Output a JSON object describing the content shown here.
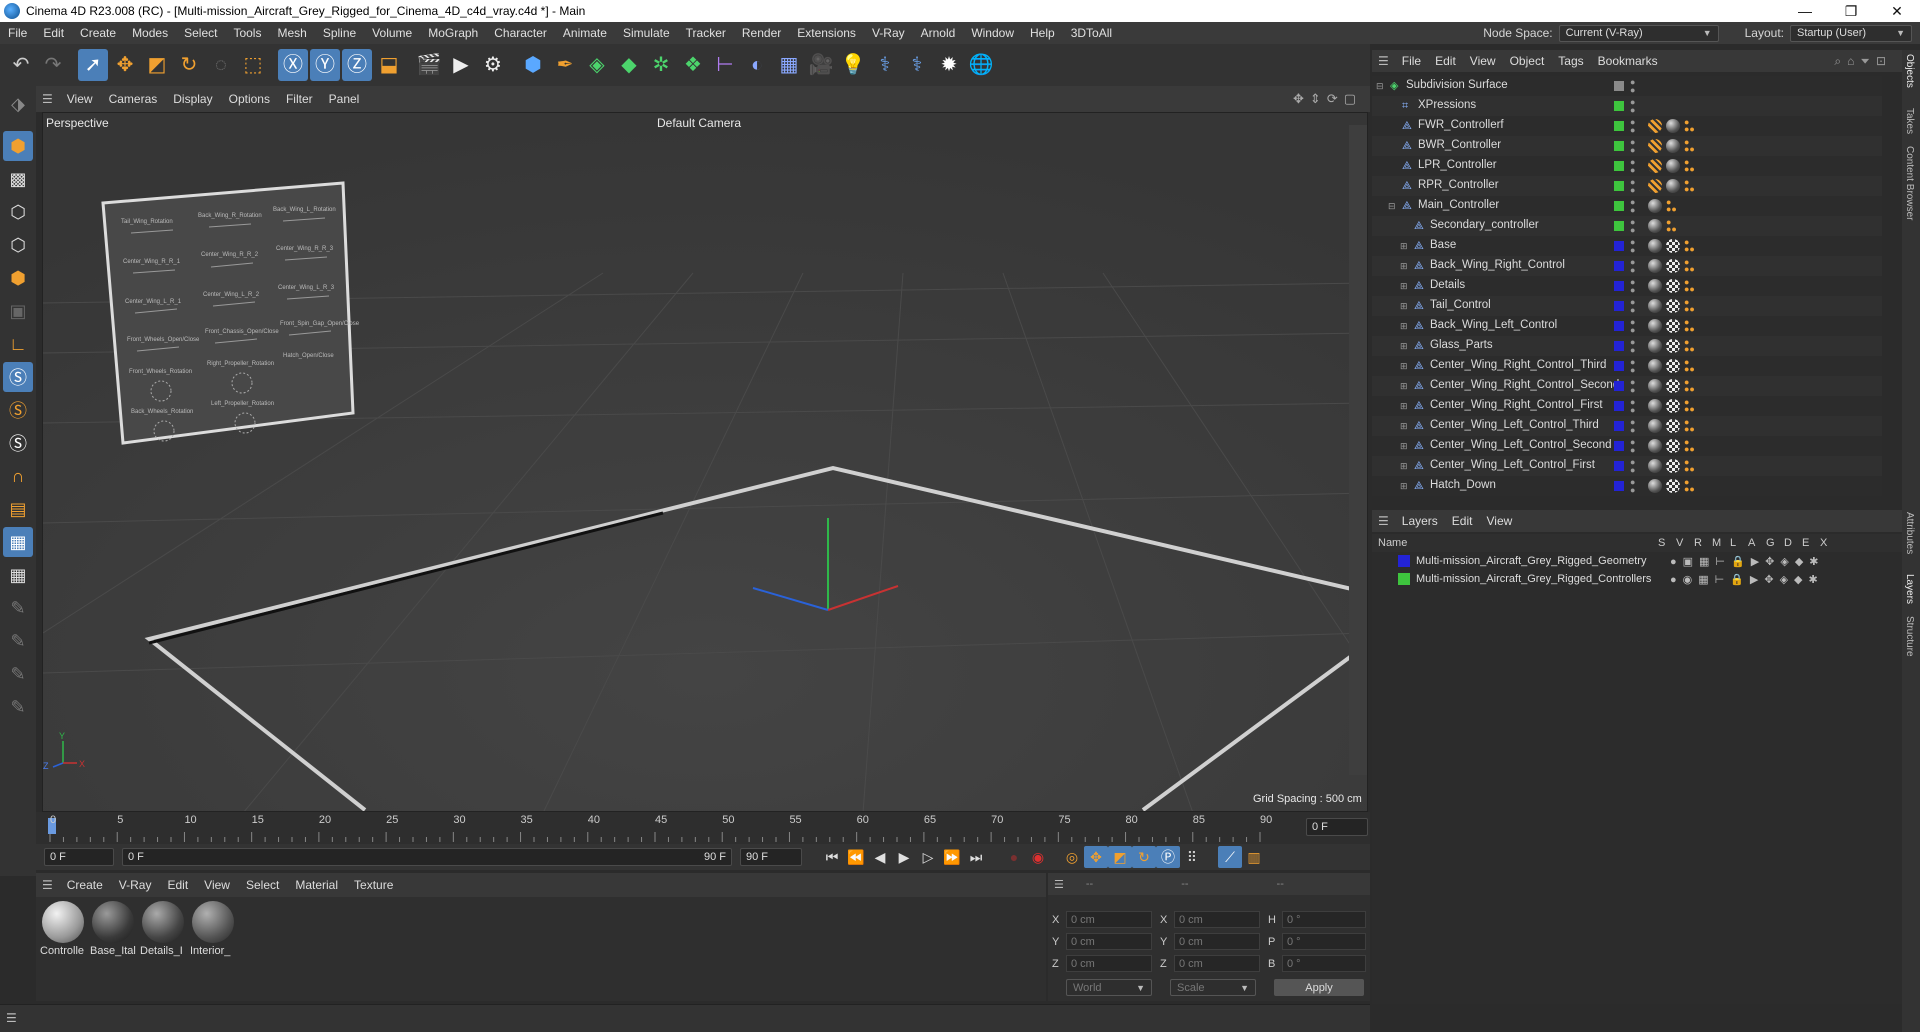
{
  "window": {
    "title": "Cinema 4D R23.008 (RC) - [Multi-mission_Aircraft_Grey_Rigged_for_Cinema_4D_c4d_vray.c4d *] - Main",
    "controls": [
      "—",
      "❐",
      "✕"
    ]
  },
  "menubar": {
    "items": [
      "File",
      "Edit",
      "Create",
      "Modes",
      "Select",
      "Tools",
      "Mesh",
      "Spline",
      "Volume",
      "MoGraph",
      "Character",
      "Animate",
      "Simulate",
      "Tracker",
      "Render",
      "Extensions",
      "V-Ray",
      "Arnold",
      "Window",
      "Help",
      "3DToAll"
    ],
    "node_space_label": "Node Space:",
    "node_space_value": "Current (V-Ray)",
    "layout_label": "Layout:",
    "layout_value": "Startup (User)"
  },
  "viewport": {
    "menu": [
      "View",
      "Cameras",
      "Display",
      "Options",
      "Filter",
      "Panel"
    ],
    "view_name": "Perspective",
    "camera": "Default Camera",
    "grid_spacing": "Grid Spacing : 500 cm"
  },
  "timeline": {
    "ticks": [
      "0",
      "5",
      "10",
      "15",
      "20",
      "25",
      "30",
      "35",
      "40",
      "45",
      "50",
      "55",
      "60",
      "65",
      "70",
      "75",
      "80",
      "85",
      "90"
    ],
    "current_frame": "0 F",
    "start_frame": "0 F",
    "range_start": "0 F",
    "range_end": "90 F",
    "end_frame": "90 F"
  },
  "materials": {
    "menu": [
      "Create",
      "V-Ray",
      "Edit",
      "View",
      "Select",
      "Material",
      "Texture"
    ],
    "items": [
      {
        "label": "Controlle",
        "color": "#bdbdbd"
      },
      {
        "label": "Base_Ital",
        "color": "#4a4a4a"
      },
      {
        "label": "Details_I",
        "color": "#5a5a5a"
      },
      {
        "label": "Interior_",
        "color": "#6a6a6a"
      }
    ]
  },
  "coordinates": {
    "header": [
      "--",
      "--",
      "--"
    ],
    "rows": [
      {
        "a": "X",
        "av": "0 cm",
        "b": "X",
        "bv": "0 cm",
        "c": "H",
        "cv": "0 °"
      },
      {
        "a": "Y",
        "av": "0 cm",
        "b": "Y",
        "bv": "0 cm",
        "c": "P",
        "cv": "0 °"
      },
      {
        "a": "Z",
        "av": "0 cm",
        "b": "Z",
        "bv": "0 cm",
        "c": "B",
        "cv": "0 °"
      }
    ],
    "mode_world": "World",
    "mode_scale": "Scale",
    "apply": "Apply"
  },
  "objects": {
    "menu": [
      "File",
      "Edit",
      "View",
      "Object",
      "Tags",
      "Bookmarks"
    ],
    "rows": [
      {
        "name": "Subdivision Surface",
        "depth": 0,
        "status": "#8a8a8a",
        "tags": 0
      },
      {
        "name": "XPressions",
        "depth": 1,
        "status": "#3ec43e",
        "tags": 0
      },
      {
        "name": "FWR_Controllerf",
        "depth": 1,
        "status": "#3ec43e",
        "tags": 2
      },
      {
        "name": "BWR_Controller",
        "depth": 1,
        "status": "#3ec43e",
        "tags": 2
      },
      {
        "name": "LPR_Controller",
        "depth": 1,
        "status": "#3ec43e",
        "tags": 2
      },
      {
        "name": "RPR_Controller",
        "depth": 1,
        "status": "#3ec43e",
        "tags": 2
      },
      {
        "name": "Main_Controller",
        "depth": 1,
        "status": "#3ec43e",
        "tags": 1
      },
      {
        "name": "Secondary_controller",
        "depth": 2,
        "status": "#3ec43e",
        "tags": 1
      },
      {
        "name": "Base",
        "depth": 2,
        "status": "#2323d6",
        "tags": 2
      },
      {
        "name": "Back_Wing_Right_Control",
        "depth": 2,
        "status": "#2323d6",
        "tags": 2
      },
      {
        "name": "Details",
        "depth": 2,
        "status": "#2323d6",
        "tags": 2
      },
      {
        "name": "Tail_Control",
        "depth": 2,
        "status": "#2323d6",
        "tags": 2
      },
      {
        "name": "Back_Wing_Left_Control",
        "depth": 2,
        "status": "#2323d6",
        "tags": 2
      },
      {
        "name": "Glass_Parts",
        "depth": 2,
        "status": "#2323d6",
        "tags": 2
      },
      {
        "name": "Center_Wing_Right_Control_Third",
        "depth": 2,
        "status": "#2323d6",
        "tags": 2
      },
      {
        "name": "Center_Wing_Right_Control_Second",
        "depth": 2,
        "status": "#2323d6",
        "tags": 2
      },
      {
        "name": "Center_Wing_Right_Control_First",
        "depth": 2,
        "status": "#2323d6",
        "tags": 2
      },
      {
        "name": "Center_Wing_Left_Control_Third",
        "depth": 2,
        "status": "#2323d6",
        "tags": 2
      },
      {
        "name": "Center_Wing_Left_Control_Second",
        "depth": 2,
        "status": "#2323d6",
        "tags": 2
      },
      {
        "name": "Center_Wing_Left_Control_First",
        "depth": 2,
        "status": "#2323d6",
        "tags": 2
      },
      {
        "name": "Hatch_Down",
        "depth": 2,
        "status": "#2323d6",
        "tags": 2
      }
    ]
  },
  "layers": {
    "menu": [
      "Layers",
      "Edit",
      "View"
    ],
    "columns": [
      "Name",
      "S",
      "V",
      "R",
      "M",
      "L",
      "A",
      "G",
      "D",
      "E",
      "X"
    ],
    "rows": [
      {
        "name": "Multi-mission_Aircraft_Grey_Rigged_Geometry",
        "color": "#2323d6"
      },
      {
        "name": "Multi-mission_Aircraft_Grey_Rigged_Controllers",
        "color": "#3ec43e"
      }
    ]
  },
  "side_tabs": [
    "Objects",
    "Takes",
    "Content Browser",
    "Attributes",
    "Layers",
    "Structure"
  ],
  "colors": {
    "accent": "#4b7fb8",
    "panel": "#2c2c2c"
  }
}
